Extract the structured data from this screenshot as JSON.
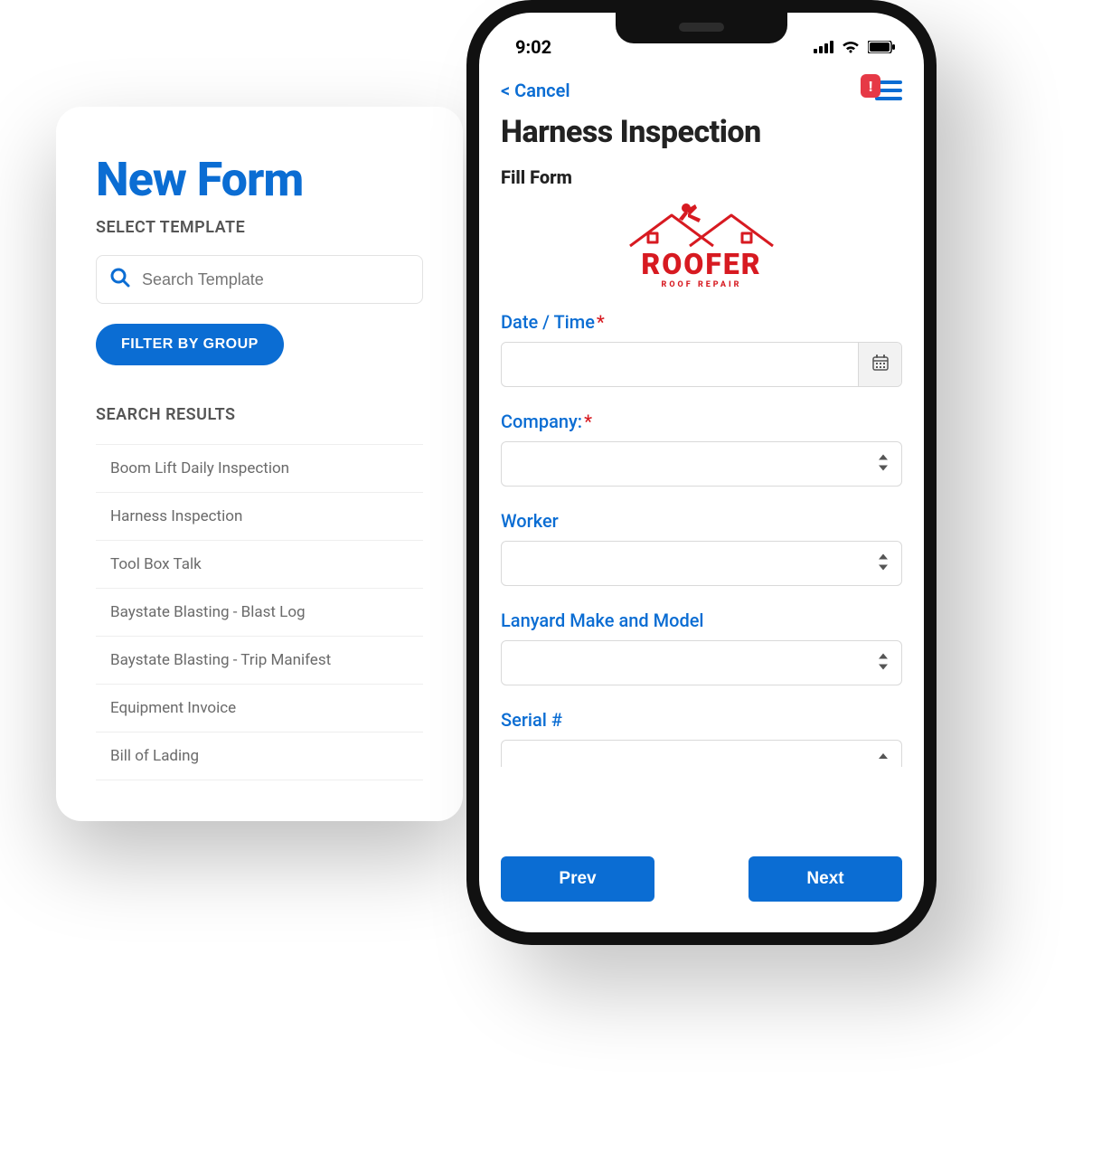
{
  "left": {
    "title": "New Form",
    "select_template_label": "SELECT TEMPLATE",
    "search_placeholder": "Search Template",
    "filter_button": "FILTER BY GROUP",
    "results_label": "SEARCH RESULTS",
    "results": [
      "Boom Lift Daily Inspection",
      "Harness Inspection",
      "Tool Box Talk",
      "Baystate Blasting - Blast Log",
      "Baystate Blasting - Trip Manifest",
      "Equipment Invoice",
      "Bill of Lading"
    ]
  },
  "phone": {
    "status_time": "9:02",
    "cancel": "< Cancel",
    "menu_badge": "!",
    "page_title": "Harness Inspection",
    "fill_form_label": "Fill Form",
    "logo": {
      "brand": "ROOFER",
      "tagline": "ROOF REPAIR"
    },
    "fields": {
      "date_time": {
        "label": "Date / Time",
        "required": true,
        "value": ""
      },
      "company": {
        "label": "Company:",
        "required": true,
        "value": ""
      },
      "worker": {
        "label": "Worker",
        "required": false,
        "value": ""
      },
      "lanyard": {
        "label": "Lanyard Make and Model",
        "required": false,
        "value": ""
      },
      "serial": {
        "label": "Serial #",
        "required": false,
        "value": ""
      }
    },
    "nav": {
      "prev": "Prev",
      "next": "Next"
    }
  }
}
